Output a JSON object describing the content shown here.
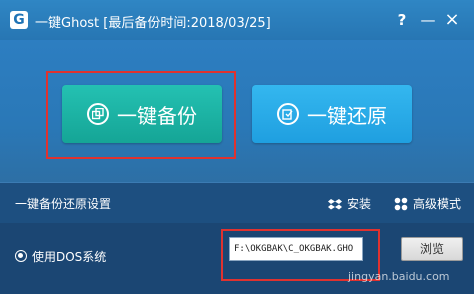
{
  "window": {
    "logo_letter": "G",
    "title": "一键Ghost [最后备份时间:2018/03/25]",
    "help_label": "?",
    "minimize_label": "—",
    "close_label": "×"
  },
  "main": {
    "backup_label": "一键备份",
    "restore_label": "一键还原"
  },
  "settings": {
    "label": "一键备份还原设置",
    "install_label": "安装",
    "advanced_label": "高级模式"
  },
  "bottom": {
    "dos_label": "使用DOS系统",
    "path_value": "F:\\OKGBAK\\C_OKGBAK.GHO",
    "browse_label": "浏览"
  },
  "watermark": "jingyan.baidu.com",
  "colors": {
    "backup_button": "#1fb5a6",
    "restore_button": "#2aabe8",
    "highlight": "#e0322f"
  },
  "icons": [
    "copy-icon",
    "restore-icon",
    "dropbox-icon",
    "grid-icon"
  ]
}
